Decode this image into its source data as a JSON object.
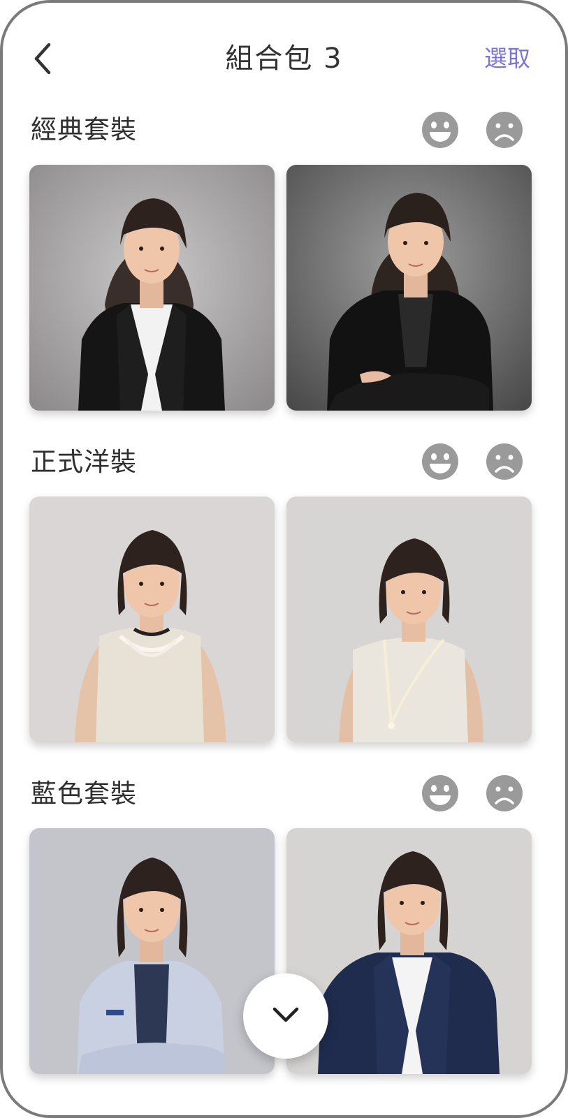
{
  "header": {
    "title": "組合包 3",
    "select_label": "選取",
    "back_icon": "chevron-left-icon"
  },
  "colors": {
    "accent": "#7b74d6",
    "icon_gray": "#9a9a9a",
    "text": "#333333"
  },
  "sections": [
    {
      "title": "經典套裝",
      "like_icon": "smiley-face-icon",
      "dislike_icon": "frowning-face-icon",
      "photos": [
        "woman-black-blazer-white-top",
        "woman-black-blazer-arms-crossed"
      ]
    },
    {
      "title": "正式洋裝",
      "like_icon": "smiley-face-icon",
      "dislike_icon": "frowning-face-icon",
      "photos": [
        "woman-knit-dress-pearl-choker",
        "woman-knit-dress-long-pearls"
      ]
    },
    {
      "title": "藍色套裝",
      "like_icon": "smiley-face-icon",
      "dislike_icon": "frowning-face-icon",
      "photos": [
        "woman-light-blue-blazer",
        "woman-navy-blazer"
      ]
    }
  ],
  "scroll_button_icon": "chevron-down-icon"
}
